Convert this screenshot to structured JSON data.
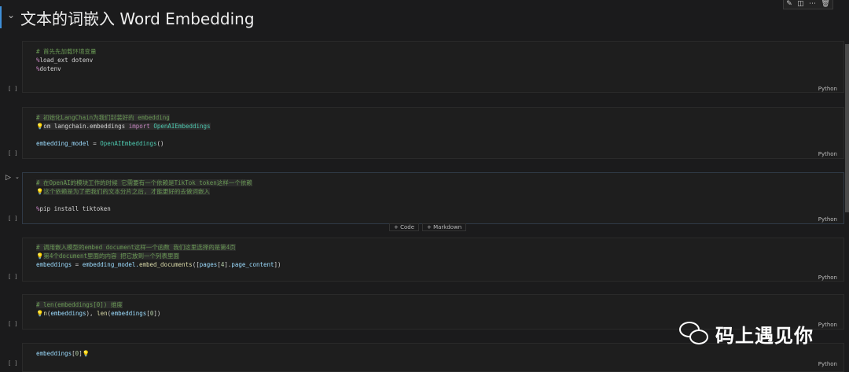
{
  "header": {
    "title": "文本的词嵌入 Word Embedding",
    "toolbar_icons": [
      "edit-icon",
      "split-icon",
      "more-icon",
      "delete-icon"
    ]
  },
  "cells": [
    {
      "bracket": "[ ]",
      "language": "Python",
      "lines": [
        [
          {
            "t": "# 首先先加载环境变量",
            "c": "comment"
          }
        ],
        [
          {
            "t": "%",
            "c": "magic"
          },
          {
            "t": "load_ext dotenv",
            "c": "plain"
          }
        ],
        [
          {
            "t": "%",
            "c": "magic"
          },
          {
            "t": "dotenv",
            "c": "plain"
          }
        ]
      ]
    },
    {
      "bracket": "[ ]",
      "language": "Python",
      "lines": [
        [
          {
            "t": "# 初始化LangChain为我们封装好的 embedding",
            "c": "comment hl"
          }
        ],
        [
          {
            "t": "💡",
            "c": "bulb"
          },
          {
            "t": "om langchain.embeddings ",
            "c": "plain hl"
          },
          {
            "t": "import ",
            "c": "kw hl"
          },
          {
            "t": "OpenAIEmbeddings",
            "c": "cls hl"
          }
        ],
        [],
        [
          {
            "t": "embedding_model ",
            "c": "ident"
          },
          {
            "t": "= ",
            "c": "plain"
          },
          {
            "t": "OpenAIEmbeddings",
            "c": "cls"
          },
          {
            "t": "()",
            "c": "plain"
          }
        ]
      ]
    },
    {
      "bracket": "[ ]",
      "language": "Python",
      "lines": [
        [
          {
            "t": "# 在OpenAI的模块工作的时候 它需要有一个依赖是TikTok token这样一个依赖",
            "c": "comment hl"
          }
        ],
        [
          {
            "t": "💡",
            "c": "bulb"
          },
          {
            "t": "这个依赖是为了把我们的文本分片之后, 才能更好的去做词嵌入",
            "c": "comment hl"
          }
        ],
        [],
        [
          {
            "t": "%",
            "c": "magic"
          },
          {
            "t": "pip install tiktoken",
            "c": "plain"
          }
        ]
      ]
    },
    {
      "bracket": "[ ]",
      "language": "Python",
      "lines": [
        [
          {
            "t": "# 调用嵌入模型的embed document这样一个函数 我们这里选择的是第4页",
            "c": "comment hl"
          }
        ],
        [
          {
            "t": "💡",
            "c": "bulb"
          },
          {
            "t": "第4个document里面的内容 把它放到一个列表里面",
            "c": "comment hl"
          }
        ],
        [
          {
            "t": "embeddings ",
            "c": "ident"
          },
          {
            "t": "= ",
            "c": "plain"
          },
          {
            "t": "embedding_model.",
            "c": "ident"
          },
          {
            "t": "embed_documents",
            "c": "fn"
          },
          {
            "t": "([",
            "c": "plain"
          },
          {
            "t": "pages",
            "c": "ident"
          },
          {
            "t": "[",
            "c": "plain"
          },
          {
            "t": "4",
            "c": "num"
          },
          {
            "t": "].",
            "c": "plain"
          },
          {
            "t": "page_content",
            "c": "ident"
          },
          {
            "t": "])",
            "c": "plain"
          }
        ]
      ]
    },
    {
      "bracket": "[ ]",
      "language": "Python",
      "lines": [
        [
          {
            "t": "# len(embeddings[0]) 维度",
            "c": "comment hl"
          }
        ],
        [
          {
            "t": "💡",
            "c": "bulb"
          },
          {
            "t": "n",
            "c": "fn"
          },
          {
            "t": "(",
            "c": "plain"
          },
          {
            "t": "embeddings",
            "c": "ident"
          },
          {
            "t": "), ",
            "c": "plain"
          },
          {
            "t": "len",
            "c": "fn"
          },
          {
            "t": "(",
            "c": "plain"
          },
          {
            "t": "embeddings",
            "c": "ident"
          },
          {
            "t": "[",
            "c": "plain"
          },
          {
            "t": "0",
            "c": "num"
          },
          {
            "t": "])",
            "c": "plain"
          }
        ]
      ]
    },
    {
      "bracket": "[ ]",
      "language": "Python",
      "lines": [
        [
          {
            "t": "embeddings",
            "c": "ident"
          },
          {
            "t": "[",
            "c": "plain"
          },
          {
            "t": "0",
            "c": "num"
          },
          {
            "t": "]",
            "c": "plain"
          },
          {
            "t": "💡",
            "c": "bulb"
          }
        ]
      ]
    }
  ],
  "insert_bar": {
    "code_label": "+ Code",
    "markdown_label": "+ Markdown"
  },
  "run_icon": "▷",
  "watermark": {
    "icon": "wechat-icon",
    "text": "码上遇见你"
  }
}
